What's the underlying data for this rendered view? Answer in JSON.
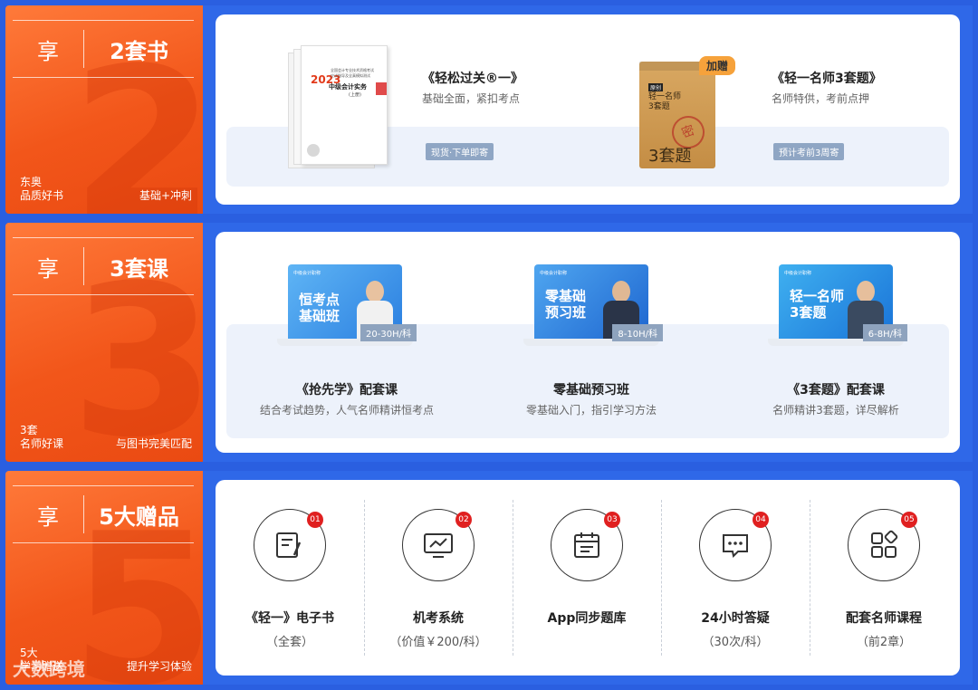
{
  "sections": [
    {
      "xiang": "享",
      "title": "2套书",
      "bignum": "2",
      "bottom_left": [
        "东奥",
        "品质好书"
      ],
      "bottom_right": "基础+冲刺",
      "products": [
        {
          "name": "《轻松过关®一》",
          "desc": "基础全面，紧扣考点",
          "tag": "现货·下单即寄",
          "cover": {
            "year": "2023",
            "line1": "全国会计专业技术资格考试",
            "line2": "应试指导及全真模拟测试",
            "subject": "中级会计实务",
            "vol": "(上册)"
          }
        },
        {
          "name": "《轻一名师3套题》",
          "desc": "名师特供，考前点押",
          "tag": "预计考前3周寄",
          "gift_badge": "加赠",
          "envelope": {
            "line0": "原创",
            "line1": "轻一名师",
            "line2": "3套题",
            "big": "3套题",
            "stamp": "密"
          }
        }
      ]
    },
    {
      "xiang": "享",
      "title": "3套课",
      "bignum": "3",
      "bottom_left": [
        "3套",
        "名师好课"
      ],
      "bottom_right": "与图书完美匹配",
      "courses": [
        {
          "screen_title": [
            "恒考点",
            "基础班"
          ],
          "hours": "20-30H/科",
          "name": "《抢先学》配套课",
          "desc": "结合考试趋势，人气名师精讲恒考点",
          "brand": "中级会计职称"
        },
        {
          "screen_title": [
            "零基础",
            "预习班"
          ],
          "hours": "8-10H/科",
          "name": "零基础预习班",
          "desc": "零基础入门，指引学习方法",
          "brand": "中级会计职称"
        },
        {
          "screen_title": [
            "轻一名师",
            "3套题"
          ],
          "hours": "6-8H/科",
          "name": "《3套题》配套课",
          "desc": "名师精讲3套题，详尽解析",
          "brand": "中级会计职称"
        }
      ]
    },
    {
      "xiang": "享",
      "title": "5大赠品",
      "bignum": "5",
      "bottom_left": [
        "5大",
        "学习赠送"
      ],
      "bottom_right": "提升学习体验",
      "gifts": [
        {
          "num": "01",
          "icon": "ebook-icon",
          "name": "《轻一》电子书",
          "sub": "（全套）"
        },
        {
          "num": "02",
          "icon": "monitor-chart-icon",
          "name": "机考系统",
          "sub": "（价值￥200/科）"
        },
        {
          "num": "03",
          "icon": "calendar-icon",
          "name": "App同步题库",
          "sub": ""
        },
        {
          "num": "04",
          "icon": "chat-bubble-icon",
          "name": "24小时答疑",
          "sub": "（30次/科）"
        },
        {
          "num": "05",
          "icon": "apps-icon",
          "name": "配套名师课程",
          "sub": "（前2章）"
        }
      ]
    }
  ],
  "watermark": "大数跨境",
  "colors": {
    "orange": "#f2561a",
    "blue": "#2f68e8",
    "tag": "#8fa6c4",
    "badge_red": "#e02020"
  }
}
